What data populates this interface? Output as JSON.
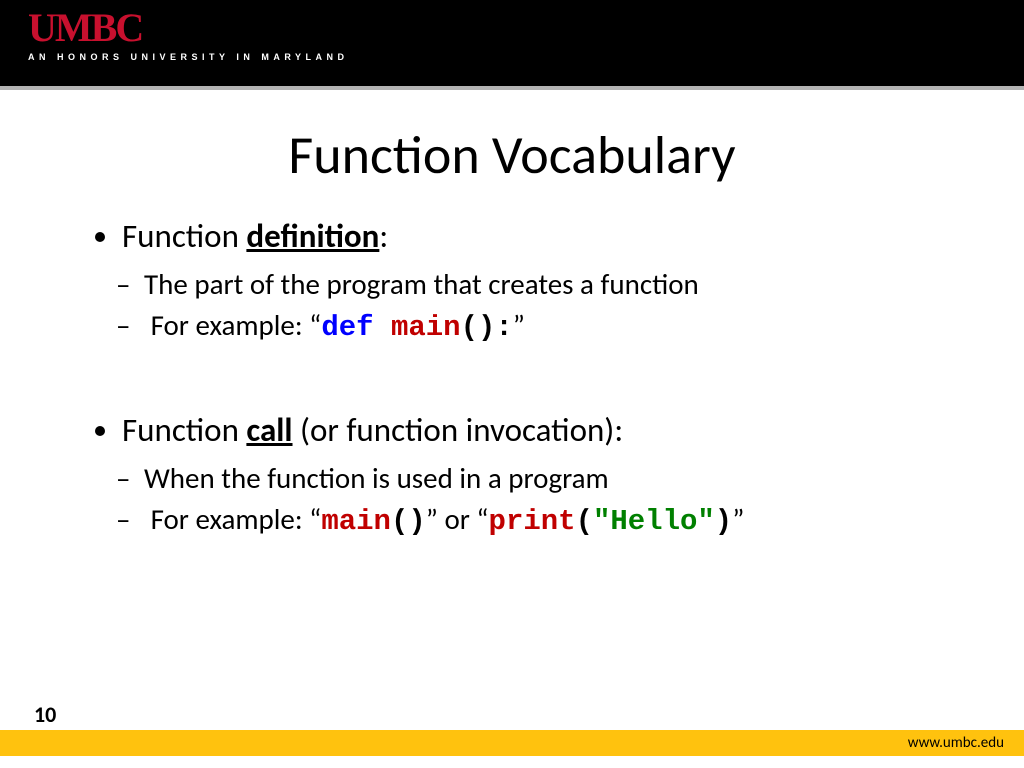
{
  "header": {
    "logo": "UMBC",
    "tagline": "AN HONORS UNIVERSITY IN MARYLAND"
  },
  "slide": {
    "title": "Function Vocabulary",
    "page_number": "10",
    "url": "www.umbc.edu",
    "b1_pre": "Function ",
    "b1_key": "definition",
    "b1_post": ":",
    "b1_sub1": "The part of the program that creates a function",
    "b1_sub2_pre": "For example: “",
    "b1_sub2_code_def": "def ",
    "b1_sub2_code_main": "main",
    "b1_sub2_code_paren": "():",
    "b1_sub2_post": "”",
    "b2_pre": "Function ",
    "b2_key": "call",
    "b2_post": " (or function invocation):",
    "b2_sub1": "When the function is used in a program",
    "b2_sub2_pre": "For example: “",
    "b2_sub2_c1_main": "main",
    "b2_sub2_c1_paren": "()",
    "b2_sub2_mid": "” or “",
    "b2_sub2_c2_print": "print",
    "b2_sub2_c2_lp": "(",
    "b2_sub2_c2_str": "\"Hello\"",
    "b2_sub2_c2_rp": ")",
    "b2_sub2_post": "”"
  }
}
